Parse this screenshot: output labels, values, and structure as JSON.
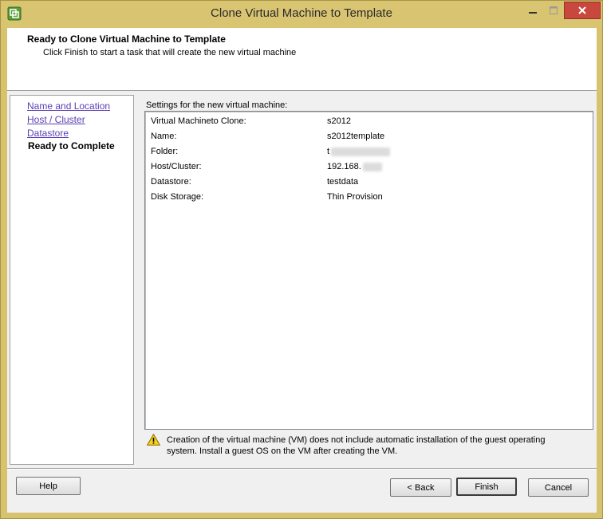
{
  "window": {
    "title": "Clone Virtual Machine to Template"
  },
  "header": {
    "title": "Ready to Clone Virtual Machine to Template",
    "subtitle": "Click Finish to start a task that will create the new virtual machine"
  },
  "nav": {
    "items": [
      {
        "label": "Name and Location",
        "state": "link"
      },
      {
        "label": "Host / Cluster",
        "state": "link"
      },
      {
        "label": "Datastore",
        "state": "link"
      },
      {
        "label": "Ready to Complete",
        "state": "current"
      }
    ]
  },
  "settings": {
    "label": "Settings for the new virtual machine:",
    "rows": [
      {
        "key": "Virtual Machineto Clone:",
        "value": "s2012"
      },
      {
        "key": "Name:",
        "value": "s2012template"
      },
      {
        "key": "Folder:",
        "value": "t"
      },
      {
        "key": "Host/Cluster:",
        "value": "192.168."
      },
      {
        "key": "Datastore:",
        "value": "testdata"
      },
      {
        "key": "Disk Storage:",
        "value": "Thin Provision"
      }
    ]
  },
  "warning": {
    "text": "Creation of the virtual machine (VM) does not include automatic installation of the guest operating system. Install a guest OS on the VM after creating the VM."
  },
  "buttons": {
    "help": "Help",
    "back": "< Back",
    "finish": "Finish",
    "cancel": "Cancel"
  },
  "colors": {
    "frame": "#d8c471",
    "close_button": "#c9483e",
    "link": "#5a3fb4"
  },
  "icons": {
    "app": "vsphere-app-icon",
    "warning": "warning-triangle-icon"
  }
}
